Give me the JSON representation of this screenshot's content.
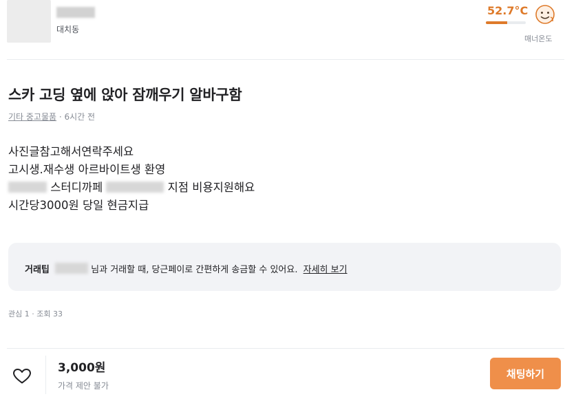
{
  "seller": {
    "region": "대치동",
    "manner_temp": "52.7°C",
    "manner_temp_level_percent": 52.7,
    "manner_label": "매너온도"
  },
  "post": {
    "title": "스카 고딩 옆에 앉아 잠깨우기 알바구함",
    "category": "기타 중고물품",
    "time": "· 6시간 전",
    "body": {
      "line1": "사진글참고해서연락주세요",
      "line2": "고시생.재수생 아르바이트생 환영",
      "line3_a": "스터디까페",
      "line3_b": "지점 비용지원해요",
      "line4": "시간당3000원 당일 현금지급"
    }
  },
  "tip": {
    "label": "거래팁",
    "text": "님과 거래할 때, 당근페이로 간편하게 송금할 수 있어요.",
    "link": "자세히 보기"
  },
  "stats": "관심 1 · 조회 33",
  "bottom": {
    "price": "3,000원",
    "negotiation": "가격 제안 불가",
    "chat_button": "채팅하기"
  },
  "colors": {
    "accent": "#de7a2a",
    "button": "#ef8f4a",
    "tip_background": "#f2f3f6"
  }
}
